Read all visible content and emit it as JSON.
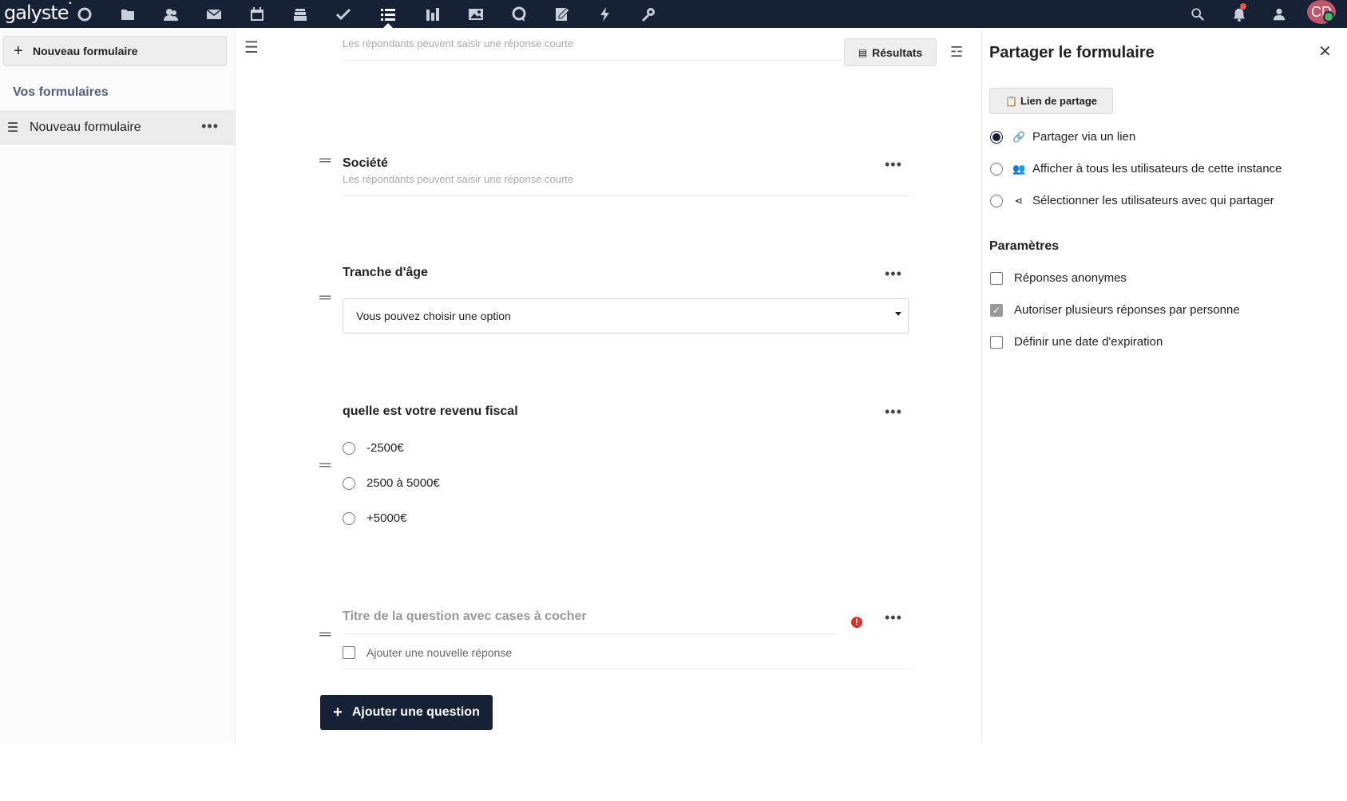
{
  "topbar": {
    "logo": "galyste",
    "logo_mark": "•",
    "apps": [
      "dashboard-icon",
      "files-icon",
      "contacts-icon",
      "mail-icon",
      "calendar-icon",
      "deck-icon",
      "tasks-icon",
      "forms-icon",
      "analytics-icon",
      "photos-icon",
      "talk-icon",
      "notes-icon",
      "activity-icon",
      "settings-icon"
    ],
    "avatar_initials": "CD"
  },
  "sidebar": {
    "new_form_label": "Nouveau formulaire",
    "caption": "Vos formulaires",
    "items": [
      {
        "label": "Nouveau formulaire",
        "more": "•••"
      }
    ]
  },
  "main": {
    "results_label": "Résultats",
    "questions": [
      {
        "hint": "Les répondants peuvent saisir une réponse courte"
      },
      {
        "title": "Société",
        "hint": "Les répondants peuvent saisir une réponse courte"
      },
      {
        "title": "Tranche d'âge",
        "select_value": "Vous pouvez choisir une option"
      },
      {
        "title": "quelle est votre revenu fiscal",
        "options": [
          "-2500€",
          "2500 à 5000€",
          "+5000€"
        ]
      },
      {
        "title_placeholder": "Titre de la question avec cases à cocher",
        "add_answer_placeholder": "Ajouter une nouvelle réponse"
      }
    ],
    "add_question_label": "Ajouter une question"
  },
  "share": {
    "title": "Partager le formulaire",
    "link_button": "Lien de partage",
    "options": [
      {
        "label": "Partager via un lien",
        "selected": true
      },
      {
        "label": "Afficher à tous les utilisateurs de cette instance",
        "selected": false
      },
      {
        "label": "Sélectionner les utilisateurs avec qui partager",
        "selected": false
      }
    ],
    "settings_title": "Paramètres",
    "settings": [
      {
        "label": "Réponses anonymes",
        "checked": false
      },
      {
        "label": "Autoriser plusieurs réponses par personne",
        "checked": true
      },
      {
        "label": "Définir une date d'expiration",
        "checked": false
      }
    ]
  },
  "colors": {
    "header_bg": "#162136",
    "accent": "#162136",
    "error": "#d9322b",
    "avatar": "#c0566b",
    "status": "#46ba61"
  }
}
